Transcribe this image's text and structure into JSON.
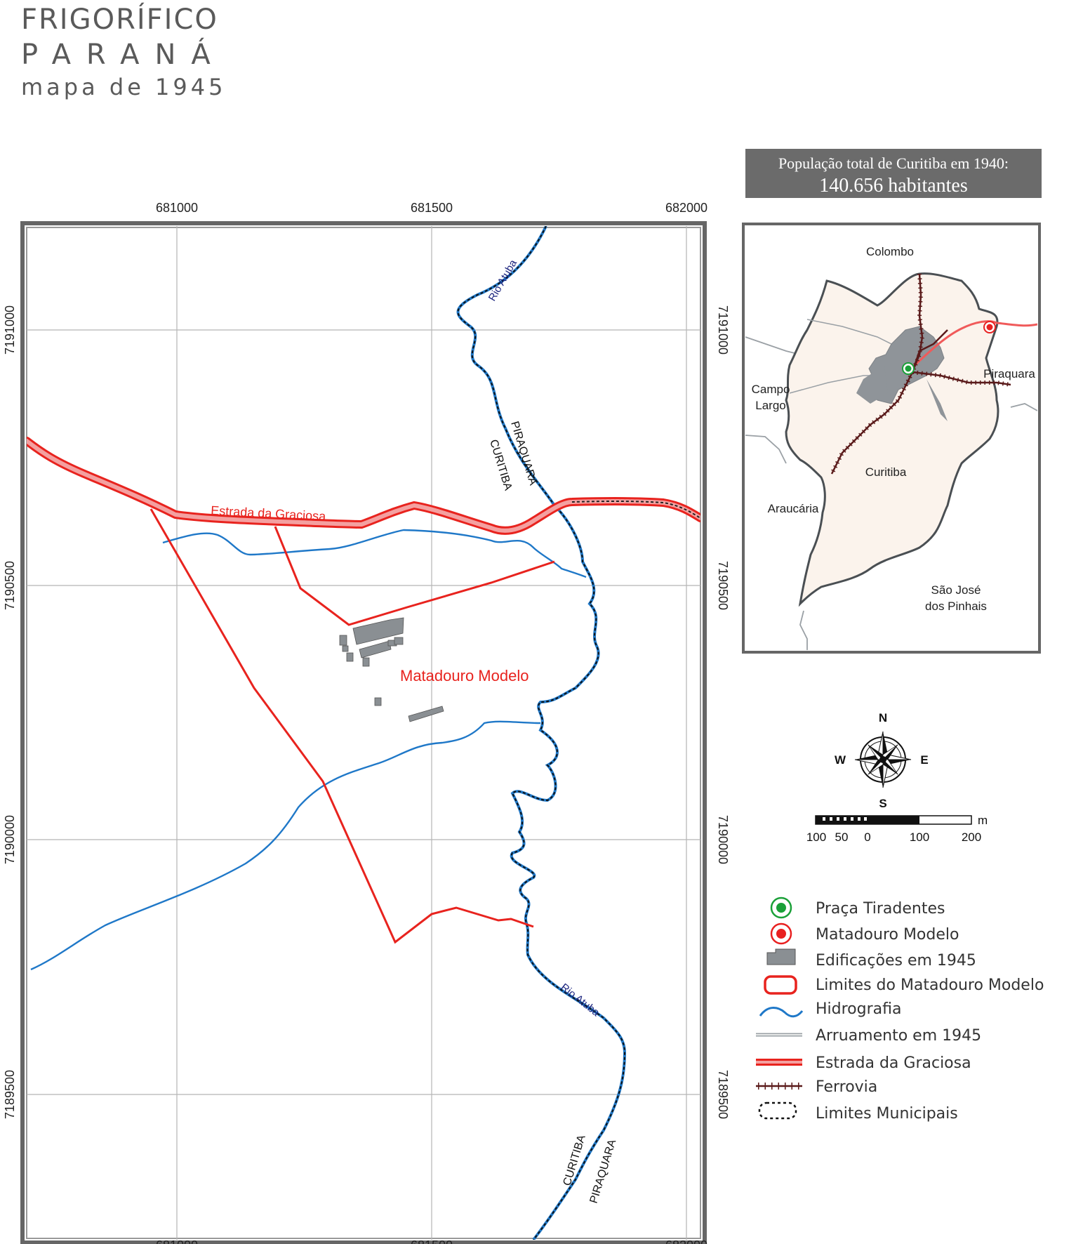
{
  "title": {
    "line1": "FRIGORÍFICO",
    "line2": "PARANÁ",
    "line3": "mapa de 1945"
  },
  "population_box": {
    "line1": "População total de Curitiba em 1940:",
    "line2": "140.656 habitantes"
  },
  "main_map": {
    "x_ticks": [
      "681000",
      "681500",
      "682000"
    ],
    "y_ticks": [
      "7191000",
      "7190500",
      "7190000",
      "7189500"
    ],
    "labels": {
      "rio_atuba_north": "Rio Atuba",
      "rio_atuba_south": "Rio Atuba",
      "piraquara_north": "PIRAQUARA",
      "curitiba_north": "CURITIBA",
      "curitiba_south": "CURITIBA",
      "piraquara_south": "PIRAQUARA",
      "estrada": "Estrada da Graciosa",
      "matadouro": "Matadouro Modelo"
    }
  },
  "inset_map": {
    "labels": {
      "colombo": "Colombo",
      "campo": "Campo",
      "largo": "Largo",
      "piraquara": "Piraquara",
      "curitiba": "Curitiba",
      "araucaria": "Araucária",
      "sao_jose1": "São José",
      "sao_jose2": "dos Pinhais"
    }
  },
  "compass": {
    "n": "N",
    "s": "S",
    "e": "E",
    "w": "W"
  },
  "scale_bar": {
    "unit": "m",
    "labels": [
      "100",
      "50",
      "0",
      "100",
      "200"
    ]
  },
  "legend": [
    {
      "symbol": "green-point-icon",
      "label": "Praça Tiradentes"
    },
    {
      "symbol": "red-point-icon",
      "label": "Matadouro Modelo"
    },
    {
      "symbol": "building-icon",
      "label": "Edificações em 1945"
    },
    {
      "symbol": "boundary-icon",
      "label": "Limites do Matadouro Modelo"
    },
    {
      "symbol": "river-icon",
      "label": "Hidrografia"
    },
    {
      "symbol": "street-icon",
      "label": "Arruamento em 1945"
    },
    {
      "symbol": "road-icon",
      "label": "Estrada da Graciosa"
    },
    {
      "symbol": "railway-icon",
      "label": "Ferrovia"
    },
    {
      "symbol": "municipal-limit-icon",
      "label": "Limites Municipais"
    }
  ],
  "colors": {
    "boundary_red": "#e8231e",
    "road_pink": "#f08a8a",
    "river_blue": "#1f78c8",
    "river_label": "#1a237e",
    "building_gray": "#8a8f93",
    "inset_fill": "#fbf3ec",
    "urban_gray": "#8f9499",
    "rail_brown": "#5a1a1a",
    "praca_green": "#1aa038",
    "matadouro_red": "#e82020"
  }
}
